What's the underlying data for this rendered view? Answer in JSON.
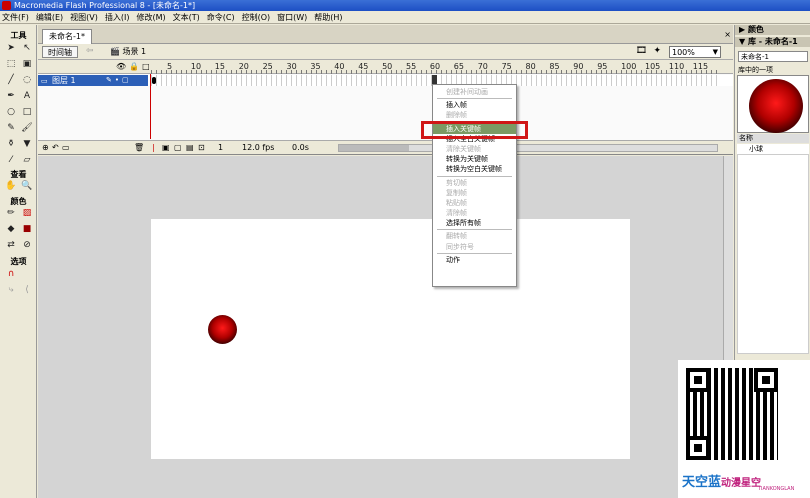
{
  "window": {
    "title": "Macromedia Flash Professional 8 - [未命名-1*]"
  },
  "menubar": [
    "文件(F)",
    "编辑(E)",
    "视图(V)",
    "插入(I)",
    "修改(M)",
    "文本(T)",
    "命令(C)",
    "控制(O)",
    "窗口(W)",
    "帮助(H)"
  ],
  "tools": {
    "header": "工具",
    "view": "查看",
    "colors": "颜色",
    "options": "选项"
  },
  "document": {
    "tab": "未命名-1*",
    "timeline_button": "时间轴",
    "scene": "场景 1",
    "zoom": "100%"
  },
  "timeline": {
    "frame_numbers": [
      "5",
      "10",
      "15",
      "20",
      "25",
      "30",
      "35",
      "40",
      "45",
      "50",
      "55",
      "60",
      "65",
      "70",
      "75",
      "80",
      "85",
      "90",
      "95",
      "100",
      "105",
      "110",
      "115"
    ],
    "layer": "图层 1",
    "current_frame": "1",
    "fps": "12.0 fps",
    "time": "0.0s"
  },
  "context_menu": {
    "items": [
      {
        "label": "创建补间动画",
        "disabled": true
      },
      {
        "sep": true
      },
      {
        "label": "插入帧",
        "disabled": false
      },
      {
        "label": "删除帧",
        "disabled": true
      },
      {
        "sep": true
      },
      {
        "label": "插入关键帧",
        "disabled": false,
        "highlighted": true
      },
      {
        "label": "插入空白关键帧",
        "disabled": false
      },
      {
        "label": "清除关键帧",
        "disabled": true
      },
      {
        "label": "转换为关键帧",
        "disabled": false
      },
      {
        "label": "转换为空白关键帧",
        "disabled": false
      },
      {
        "sep": true
      },
      {
        "label": "剪切帧",
        "disabled": true
      },
      {
        "label": "复制帧",
        "disabled": true
      },
      {
        "label": "粘贴帧",
        "disabled": true
      },
      {
        "label": "清除帧",
        "disabled": true
      },
      {
        "label": "选择所有帧",
        "disabled": false
      },
      {
        "sep": true
      },
      {
        "label": "翻转帧",
        "disabled": true
      },
      {
        "label": "同步符号",
        "disabled": true
      },
      {
        "sep": true
      },
      {
        "label": "动作",
        "disabled": false
      }
    ]
  },
  "right_panel": {
    "colors_header": "颜色",
    "library_header": "库 - 未命名-1",
    "library_doc": "未命名-1",
    "library_count": "库中的一项",
    "name_col": "名称",
    "item": "小球"
  },
  "watermark": {
    "brand": "天空蓝",
    "sub": "动漫星空",
    "en": "TIANKONGLAN"
  },
  "colors": {
    "highlight_border": "#d01616",
    "menu_highlight": "#7b9a63",
    "ball": "#cc0000"
  }
}
